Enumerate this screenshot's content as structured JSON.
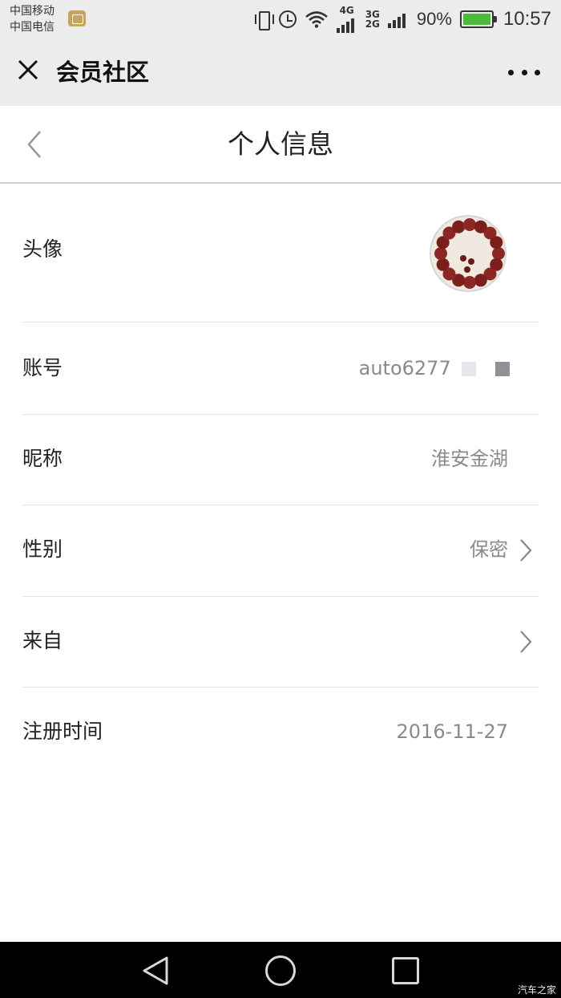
{
  "status_bar": {
    "carrier_1": "中国移动",
    "carrier_2": "中国电信",
    "net_4g": "4G",
    "net_3g": "3G",
    "net_2g": "2G",
    "battery": "90%",
    "time": "10:57"
  },
  "app_bar": {
    "close_icon": "close-icon",
    "title": "会员社区",
    "more_icon": "more-dots-icon"
  },
  "page": {
    "title": "个人信息",
    "back_icon": "chevron-left-icon"
  },
  "rows": [
    {
      "label": "头像",
      "value": ""
    },
    {
      "label": "账号",
      "value": "auto6277"
    },
    {
      "label": "昵称",
      "value": "淮安金湖"
    },
    {
      "label": "性别",
      "value": "保密"
    },
    {
      "label": "来自",
      "value": ""
    },
    {
      "label": "注册时间",
      "value": "2016-11-27"
    }
  ],
  "nav_bar": {
    "back_icon": "triangle-back-icon",
    "home_icon": "circle-home-icon",
    "recent_icon": "square-recent-icon"
  },
  "watermark": "汽车之家",
  "colors": {
    "bar_bg": "#ececec",
    "value_text": "#8a8a8a",
    "battery_fill": "#4cbb3c",
    "nav_bg": "#000000"
  }
}
